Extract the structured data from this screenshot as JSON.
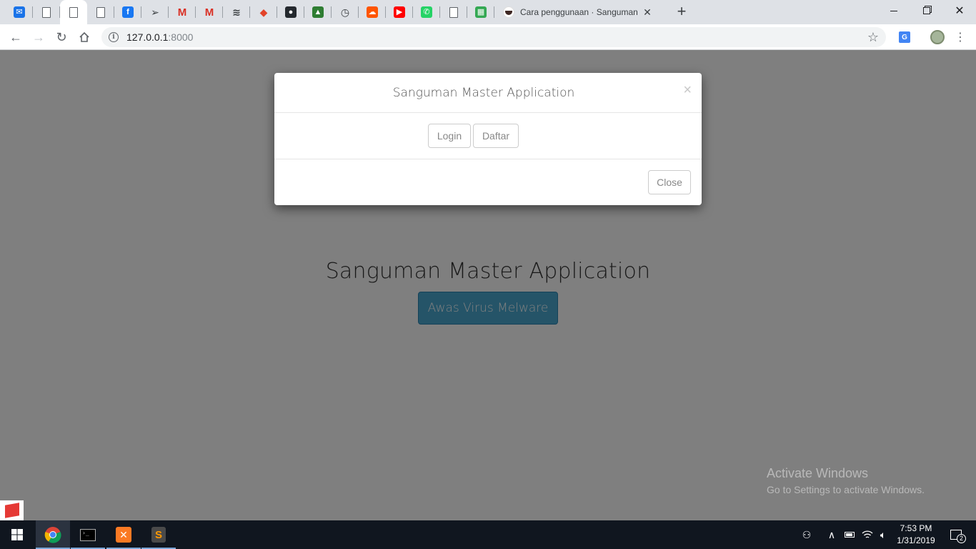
{
  "browser": {
    "active_tab_title": "Cara penggunaan · Sanguman",
    "address_host": "127.0.0.1",
    "address_port": ":8000",
    "pinned_tabs": [
      {
        "icon": "mail-app-icon",
        "color": "#1a73e8"
      },
      {
        "icon": "document-icon"
      },
      {
        "icon": "document-icon",
        "active": true
      },
      {
        "icon": "document-icon"
      },
      {
        "icon": "facebook-icon",
        "color": "#1877f2"
      },
      {
        "icon": "send-icon"
      },
      {
        "icon": "gmail-icon",
        "color": "#d93025"
      },
      {
        "icon": "gmail-icon",
        "color": "#d93025"
      },
      {
        "icon": "wave-icon"
      },
      {
        "icon": "gitlab-icon",
        "color": "#e24329"
      },
      {
        "icon": "github-icon",
        "color": "#24292e"
      },
      {
        "icon": "landscape-icon",
        "color": "#2e7d32"
      },
      {
        "icon": "clock-icon"
      },
      {
        "icon": "soundcloud-icon",
        "color": "#ff5500"
      },
      {
        "icon": "youtube-icon",
        "color": "#ff0000"
      },
      {
        "icon": "whatsapp-icon",
        "color": "#25d366"
      },
      {
        "icon": "document-icon"
      },
      {
        "icon": "sheet-icon",
        "color": "#34a853"
      }
    ]
  },
  "page": {
    "title": "Sanguman Master Application",
    "cta_label": "Awas Virus Melware",
    "cta_color": "#4aa9d1"
  },
  "modal": {
    "title": "Sanguman Master Application",
    "close_x": "×",
    "login_label": "Login",
    "register_label": "Daftar",
    "close_label": "Close"
  },
  "watermark": {
    "line1": "Activate Windows",
    "line2": "Go to Settings to activate Windows."
  },
  "taskbar": {
    "time": "7:53 PM",
    "date": "1/31/2019",
    "notification_count": "2"
  }
}
